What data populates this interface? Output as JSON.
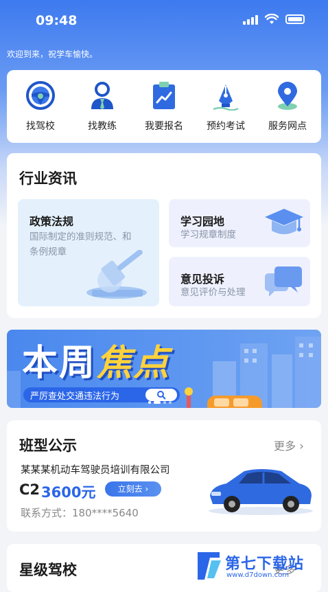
{
  "status": {
    "time": "09:48"
  },
  "welcome": "欢迎到来，祝学车愉快。",
  "quick_nav": [
    {
      "label": "找驾校",
      "icon": "steering-wheel-icon"
    },
    {
      "label": "找教练",
      "icon": "coach-icon"
    },
    {
      "label": "我要报名",
      "icon": "clipboard-chart-icon"
    },
    {
      "label": "预约考试",
      "icon": "pen-icon"
    },
    {
      "label": "服务网点",
      "icon": "location-pin-icon"
    }
  ],
  "news": {
    "title": "行业资讯",
    "policy": {
      "title": "政策法规",
      "desc_line1": "国际制定的准则规范、和",
      "desc_line2": "条例规章"
    },
    "study": {
      "title": "学习园地",
      "desc": "学习规章制度"
    },
    "complaint": {
      "title": "意见投诉",
      "desc": "意见评价与处理"
    }
  },
  "banner": {
    "title_white": "本周",
    "title_yellow": "焦点",
    "subtitle": "严厉查处交通违法行为"
  },
  "class_notice": {
    "title": "班型公示",
    "more": "更多",
    "company": "某某某机动车驾驶员培训有限公司",
    "license_type": "C2",
    "price": "3600元",
    "button": "立刻去",
    "contact": "联系方式：180****5640"
  },
  "star_school": {
    "title": "星级驾校",
    "more": "更多"
  },
  "watermark": {
    "text": "第七下载站",
    "url": "www.d7down.com"
  },
  "colors": {
    "primary": "#2b66e8",
    "banner_yellow": "#ffd23c"
  }
}
